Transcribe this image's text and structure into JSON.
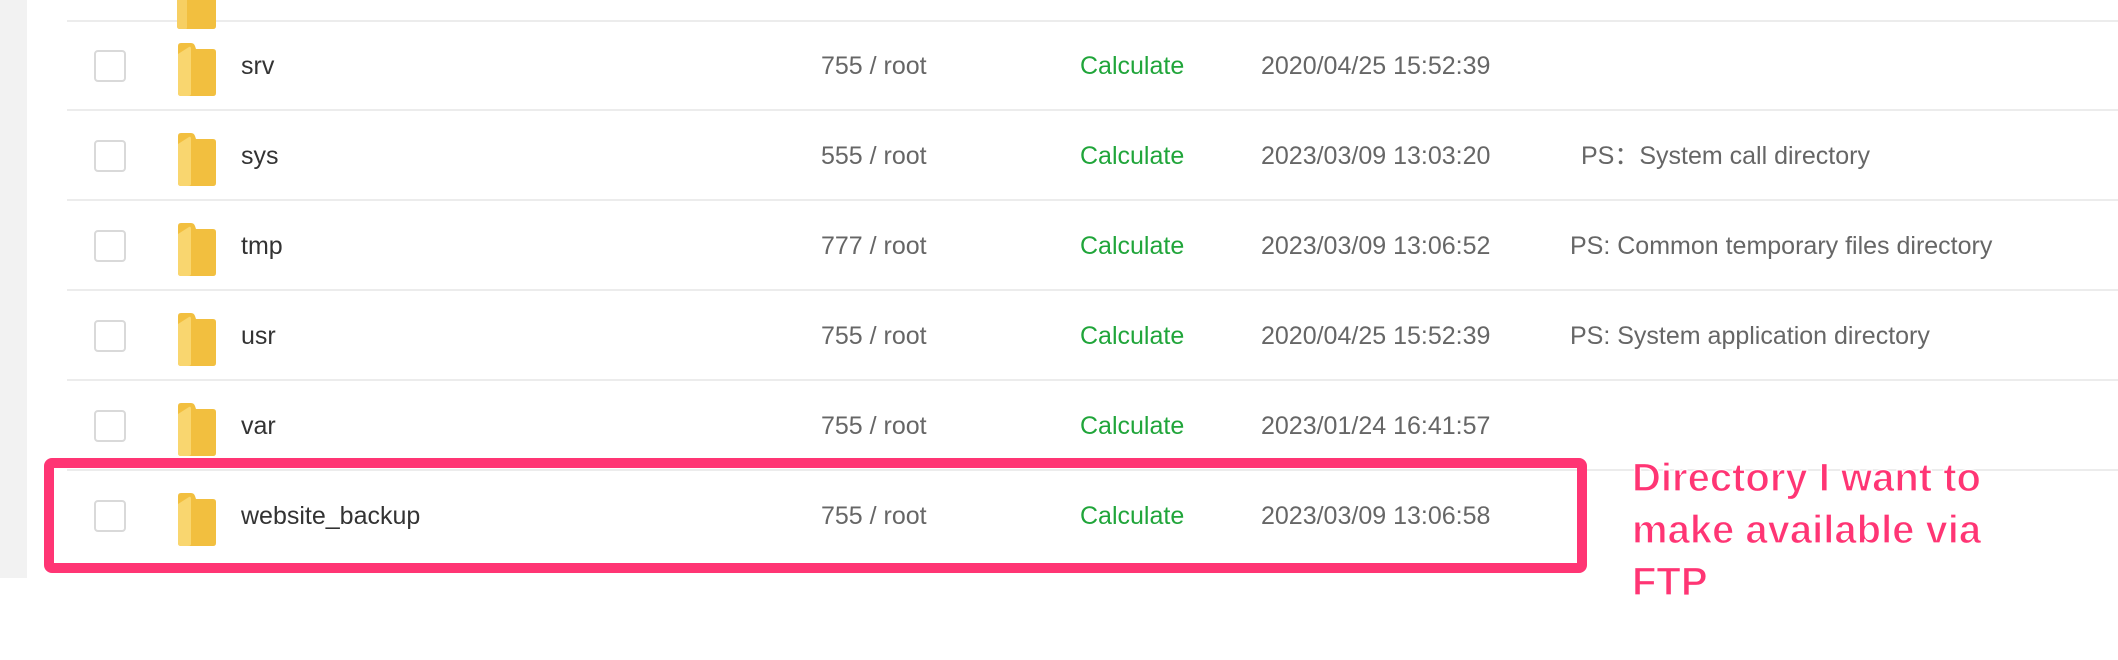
{
  "colors": {
    "calculate_link": "#20a53a",
    "highlight": "#ff3574",
    "folder": "#f7cf62",
    "row_divider": "#ececec"
  },
  "icons": {
    "folder": "folder-icon",
    "checkbox": "checkbox-unchecked"
  },
  "file_list": {
    "rows": [
      {
        "name": "srv",
        "permissions": "755 / root",
        "size_action": "Calculate",
        "modified": "2020/04/25 15:52:39",
        "note": ""
      },
      {
        "name": "sys",
        "permissions": "555 / root",
        "size_action": "Calculate",
        "modified": "2023/03/09 13:03:20",
        "note": "PS：System call directory"
      },
      {
        "name": "tmp",
        "permissions": "777 / root",
        "size_action": "Calculate",
        "modified": "2023/03/09 13:06:52",
        "note": "PS: Common temporary files directory"
      },
      {
        "name": "usr",
        "permissions": "755 / root",
        "size_action": "Calculate",
        "modified": "2020/04/25 15:52:39",
        "note": "PS: System application directory"
      },
      {
        "name": "var",
        "permissions": "755 / root",
        "size_action": "Calculate",
        "modified": "2023/01/24 16:41:57",
        "note": ""
      },
      {
        "name": "website_backup",
        "permissions": "755 / root",
        "size_action": "Calculate",
        "modified": "2023/03/09 13:06:58",
        "note": ""
      }
    ]
  },
  "annotation": {
    "text": "Directory I want to make available via FTP"
  }
}
